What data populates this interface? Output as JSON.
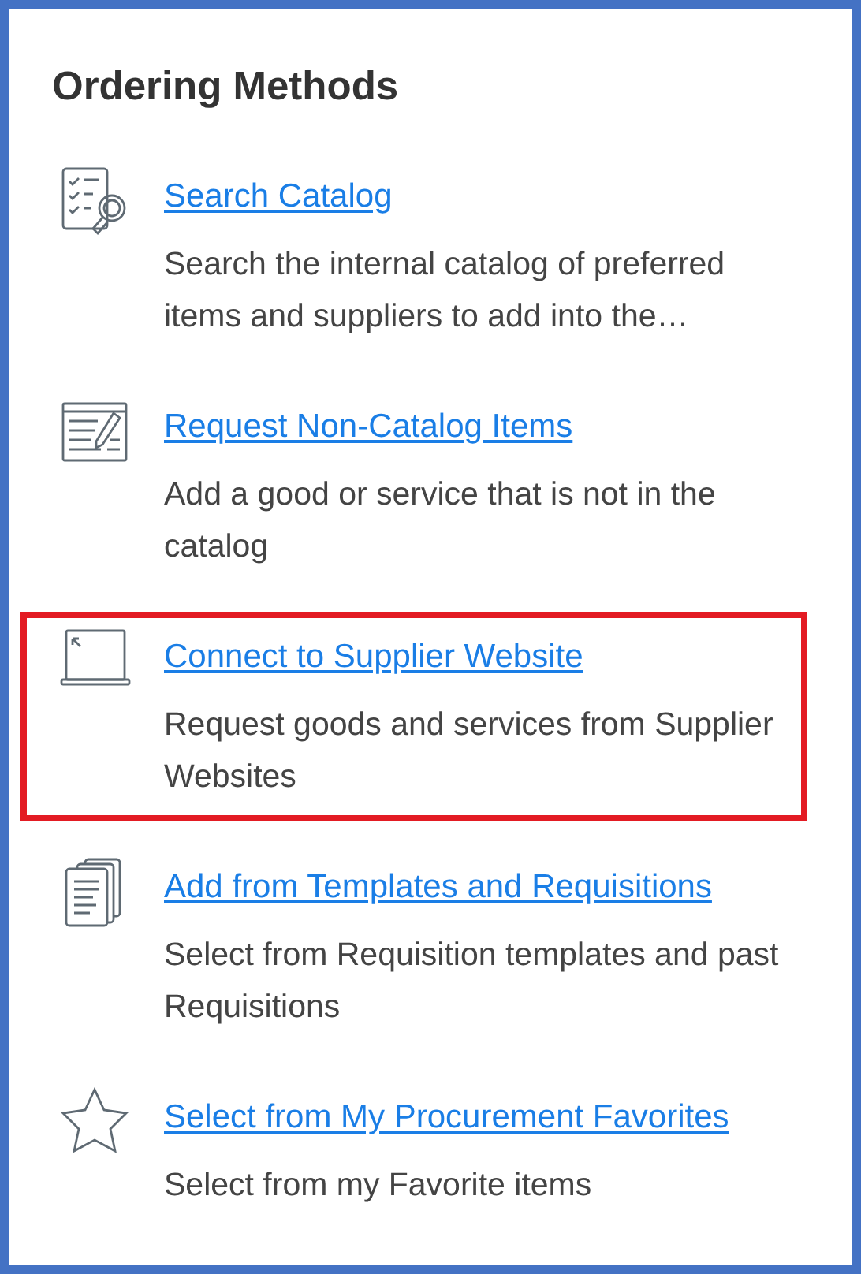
{
  "panel": {
    "title": "Ordering Methods",
    "methods": [
      {
        "kind": "catalog",
        "link": "Search Catalog",
        "description": "Search the internal catalog of preferred items and suppliers to add into the…",
        "highlighted": false
      },
      {
        "kind": "form",
        "link": "Request Non-Catalog Items",
        "description": "Add a good or service that is not in the catalog",
        "highlighted": false
      },
      {
        "kind": "laptop",
        "link": "Connect to Supplier Website",
        "description": "Request goods and services from Supplier Websites",
        "highlighted": true
      },
      {
        "kind": "documents",
        "link": "Add from Templates and Requisitions",
        "description": "Select from Requisition templates and past Requisitions",
        "highlighted": false
      },
      {
        "kind": "star",
        "link": "Select from My Procurement Favorites",
        "description": "Select from my Favorite items",
        "highlighted": false
      }
    ]
  }
}
